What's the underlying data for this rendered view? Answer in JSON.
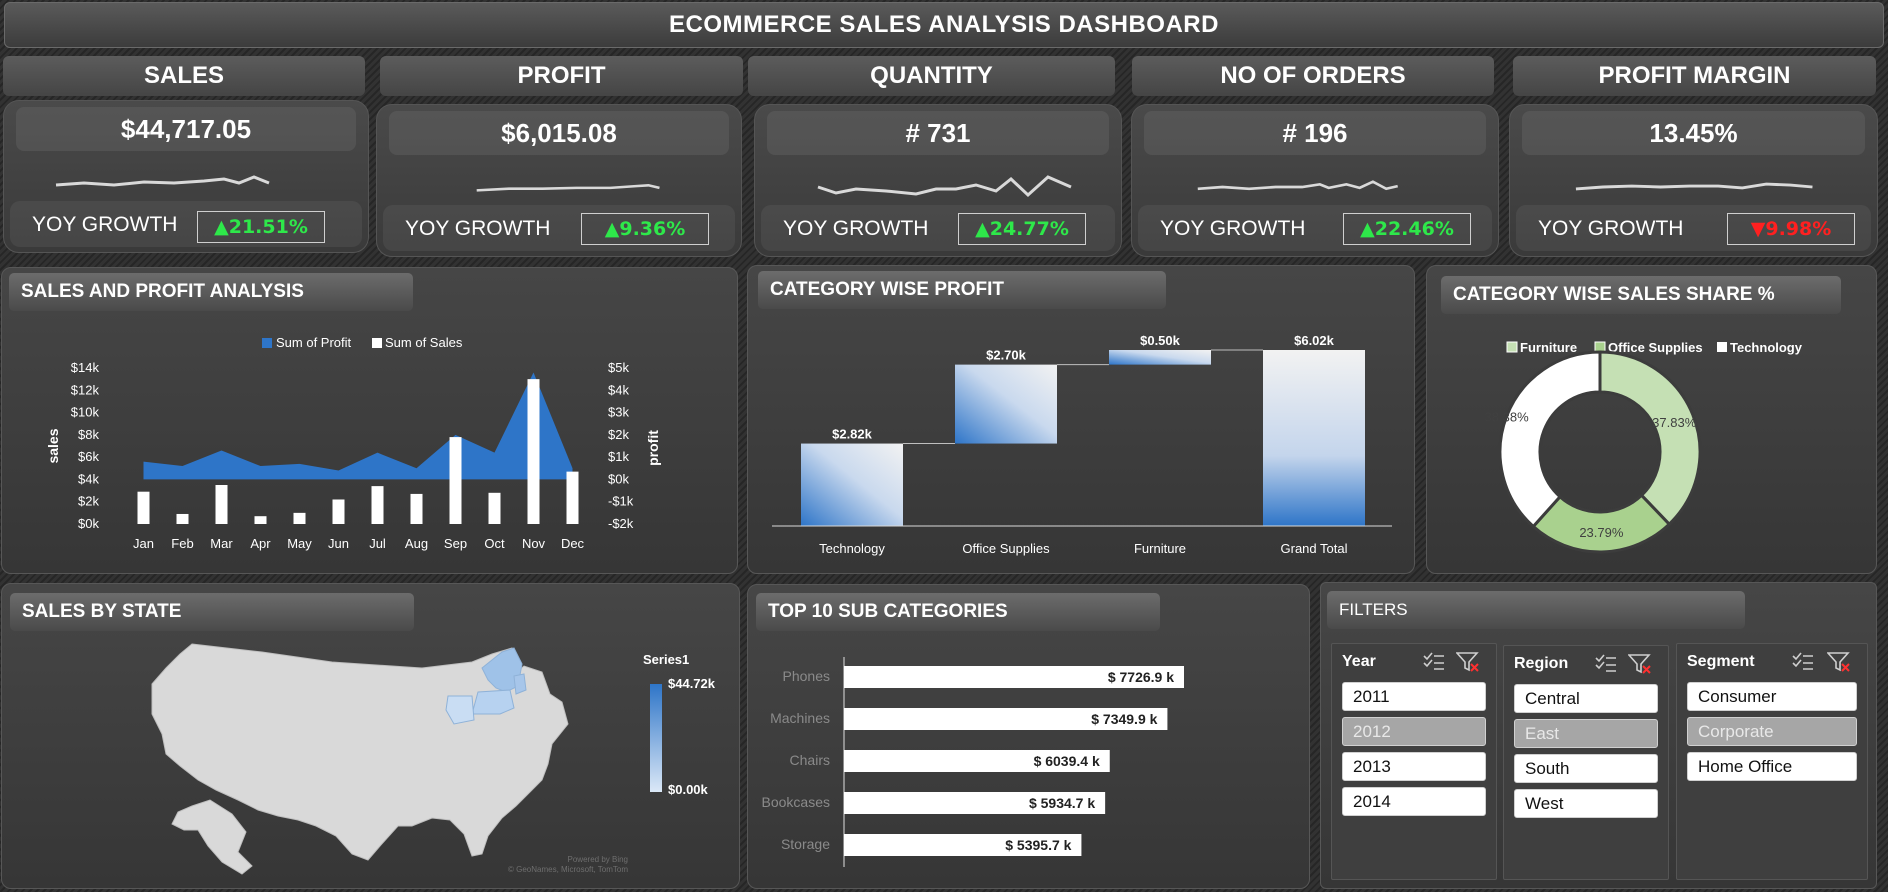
{
  "dashboard": {
    "title": "ECOMMERCE SALES ANALYSIS DASHBOARD"
  },
  "kpis": [
    {
      "label": "SALES",
      "value": "$44,717.05",
      "yoy_label": "YOY GROWTH",
      "yoy": "▲21.51%",
      "direction": "up"
    },
    {
      "label": "PROFIT",
      "value": "$6,015.08",
      "yoy_label": "YOY GROWTH",
      "yoy": "▲9.36%",
      "direction": "up"
    },
    {
      "label": "QUANTITY",
      "value": "# 731",
      "yoy_label": "YOY GROWTH",
      "yoy": "▲24.77%",
      "direction": "up"
    },
    {
      "label": "NO OF ORDERS",
      "value": "# 196",
      "yoy_label": "YOY GROWTH",
      "yoy": "▲22.46%",
      "direction": "up"
    },
    {
      "label": "PROFIT MARGIN",
      "value": "13.45%",
      "yoy_label": "YOY GROWTH",
      "yoy": "▼9.98%",
      "direction": "down"
    }
  ],
  "panels": {
    "sales_profit": "SALES AND PROFIT ANALYSIS",
    "category_profit": "CATEGORY WISE PROFIT",
    "category_share": "CATEGORY WISE SALES SHARE %",
    "sales_by_state": "SALES BY STATE",
    "top_sub": "TOP 10 SUB CATEGORIES",
    "filters": "FILTERS"
  },
  "colors": {
    "blue": "#2e75c8",
    "light_green": "#c5e0b4",
    "white": "#ffffff",
    "up": "#2ee84a",
    "down": "#ff2020"
  },
  "chart_data": [
    {
      "type": "bar",
      "title": "SALES AND PROFIT ANALYSIS",
      "categories": [
        "Jan",
        "Feb",
        "Mar",
        "Apr",
        "May",
        "Jun",
        "Jul",
        "Aug",
        "Sep",
        "Oct",
        "Nov",
        "Dec"
      ],
      "series": [
        {
          "name": "Sum of Sales",
          "type": "bar",
          "axis": "left",
          "values": [
            2900,
            900,
            3500,
            700,
            1000,
            2200,
            3400,
            2700,
            7800,
            2800,
            13000,
            4700
          ]
        },
        {
          "name": "Sum of Profit",
          "type": "area",
          "axis": "right",
          "values": [
            800,
            600,
            1300,
            600,
            700,
            400,
            1200,
            500,
            2000,
            1200,
            4800,
            500
          ]
        }
      ],
      "ylabel": "sales",
      "y2label": "profit",
      "ylim": [
        0,
        14000
      ],
      "y2lim": [
        -2000,
        5000
      ],
      "yticks": [
        "$0k",
        "$2k",
        "$4k",
        "$6k",
        "$8k",
        "$10k",
        "$12k",
        "$14k"
      ],
      "y2ticks": [
        "-$2k",
        "-$1k",
        "$0k",
        "$1k",
        "$2k",
        "$3k",
        "$4k",
        "$5k"
      ],
      "legend": "top"
    },
    {
      "type": "bar",
      "subtype": "waterfall",
      "title": "CATEGORY WISE PROFIT",
      "categories": [
        "Technology",
        "Office Supplies",
        "Furniture",
        "Grand Total"
      ],
      "values": [
        2.82,
        2.7,
        0.5,
        6.02
      ],
      "labels": [
        "$2.82k",
        "$2.70k",
        "$0.50k",
        "$6.02k"
      ],
      "units": "thousands of dollars"
    },
    {
      "type": "pie",
      "subtype": "doughnut",
      "title": "CATEGORY WISE SALES SHARE %",
      "categories": [
        "Furniture",
        "Office Supplies",
        "Technology"
      ],
      "values": [
        37.83,
        23.79,
        38.38
      ],
      "labels": [
        "37.83%",
        "23.79%",
        "38.38%"
      ],
      "legend": "top"
    },
    {
      "type": "bar",
      "orientation": "horizontal",
      "title": "TOP 10 SUB CATEGORIES",
      "categories": [
        "Phones",
        "Machines",
        "Chairs",
        "Bookcases",
        "Storage"
      ],
      "values": [
        7726.9,
        7349.9,
        6039.4,
        5934.7,
        5395.7
      ],
      "labels": [
        "$ 7726.9 k",
        "$ 7349.9 k",
        "$ 6039.4 k",
        "$ 5934.7 k",
        "$ 5395.7 k"
      ]
    }
  ],
  "map": {
    "legend_title": "Series1",
    "legend_max": "$44.72k",
    "legend_min": "$0.00k",
    "credit": [
      "Powered by Bing",
      "© GeoNames, Microsoft, TomTom"
    ]
  },
  "filters": {
    "year": {
      "title": "Year",
      "items": [
        {
          "label": "2011",
          "selected": true
        },
        {
          "label": "2012",
          "selected": false
        },
        {
          "label": "2013",
          "selected": true
        },
        {
          "label": "2014",
          "selected": true
        }
      ]
    },
    "region": {
      "title": "Region",
      "items": [
        {
          "label": "Central",
          "selected": true
        },
        {
          "label": "East",
          "selected": false
        },
        {
          "label": "South",
          "selected": true
        },
        {
          "label": "West",
          "selected": true
        }
      ]
    },
    "segment": {
      "title": "Segment",
      "items": [
        {
          "label": "Consumer",
          "selected": true
        },
        {
          "label": "Corporate",
          "selected": false
        },
        {
          "label": "Home Office",
          "selected": true
        }
      ]
    }
  }
}
